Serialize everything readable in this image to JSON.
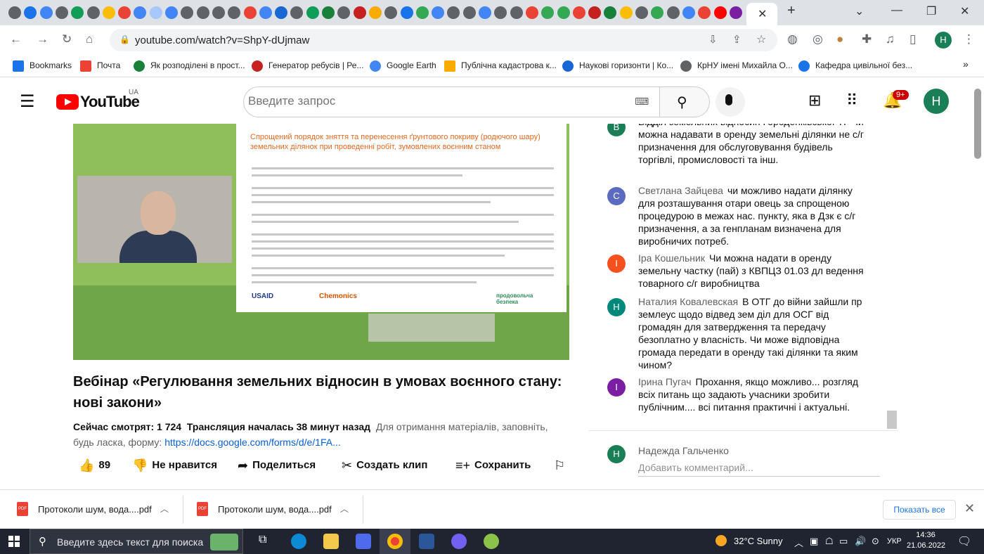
{
  "browser": {
    "url": "youtube.com/watch?v=ShpY-dUjmaw",
    "bookmarks": [
      {
        "label": "Bookmarks",
        "color": "#1a73e8"
      },
      {
        "label": "Почта",
        "color": "#ea4335"
      },
      {
        "label": "Як розподілені в прост...",
        "color": "#188038"
      },
      {
        "label": "Генератор ребусів | Ре...",
        "color": "#c5221f"
      },
      {
        "label": "Google Earth",
        "color": "#4285f4"
      },
      {
        "label": "Публічна кадастрова к...",
        "color": "#f9ab00"
      },
      {
        "label": "Наукові горизонти | Ко...",
        "color": "#1967d2"
      },
      {
        "label": "КрНУ імені Михайла О...",
        "color": "#5f6368"
      },
      {
        "label": "Кафедра цивільної без...",
        "color": "#1a73e8"
      }
    ],
    "tab_close": "✕",
    "new_tab": "+"
  },
  "youtube": {
    "logo": "YouTube",
    "region": "UA",
    "search_placeholder": "Введите запрос",
    "notif_count": "9+",
    "avatar_letter": "H"
  },
  "video": {
    "slide_title": "Спрощений порядок зняття та перенесення ґрунтового покриву (родючого шару) земельних ділянок при проведенні робіт, зумовлених воєнним станом",
    "logos": [
      "USAID",
      "Chemonics",
      "продовольча безпека"
    ],
    "title": "Вебінар «Регулювання земельних відносин в умовах воєнного стану: нові закони»",
    "viewers": "Сейчас смотрят: 1 724",
    "started": "Трансляция началась 38 минут назад",
    "desc": "Для отримання матеріалів, заповніть, будь ласка, форму:",
    "link": "https://docs.google.com/forms/d/e/1FA...",
    "likes": "89",
    "dislike": "Не нравится",
    "share": "Поделиться",
    "clip": "Создать клип",
    "save": "Сохранить"
  },
  "chat": {
    "messages": [
      {
        "letter": "В",
        "color": "#1a7f56",
        "author": "",
        "text": "Відділ земельних відносин Городенківської ТГ Чи можна надавати в оренду земельні ділянки не с/г призначення для обслуговування будівель торгівлі, промисловості та інш."
      },
      {
        "letter": "С",
        "color": "#5c6bc0",
        "author": "Светлана Зайцева",
        "text": "чи можливо надати ділянку для розташування отари овець за спрощеною процедурою в межах нас. пункту, яка в Дзк є с/г призначення, а за генпланам визначена для виробничих потреб."
      },
      {
        "letter": "І",
        "color": "#f4511e",
        "author": "Іра Кошельник",
        "text": "Чи можна надати в оренду земельну частку (пай) з КВПЦЗ 01.03 дл ведення товарного с/г виробництва"
      },
      {
        "letter": "Н",
        "color": "#00897b",
        "author": "Наталия Ковалевская",
        "text": "В ОТГ до війни зайшли пр землеус щодо відвед зем діл для ОСГ від громадян для затвердження та передачу безоплатно у власність. Чи може відповідна громада передати в оренду такі ділянки та яким чином?"
      },
      {
        "letter": "І",
        "color": "#7b1fa2",
        "author": "Ірина Пугач",
        "text": "Прохання, якщо можливо... розгляд всіх питань що задають учасники зробити публічним.... всі питання практичні і актуальні."
      }
    ],
    "input_letter": "Н",
    "input_name": "Надежда Гальченко",
    "input_placeholder": "Добавить комментарий..."
  },
  "downloads": {
    "items": [
      "Протоколи шум, вода....pdf",
      "Протоколи шум, вода....pdf"
    ],
    "show_all": "Показать все"
  },
  "taskbar": {
    "search_placeholder": "Введите здесь текст для поиска",
    "weather": "32°C Sunny",
    "lang": "УКР",
    "time": "14:36",
    "date": "21.06.2022"
  }
}
